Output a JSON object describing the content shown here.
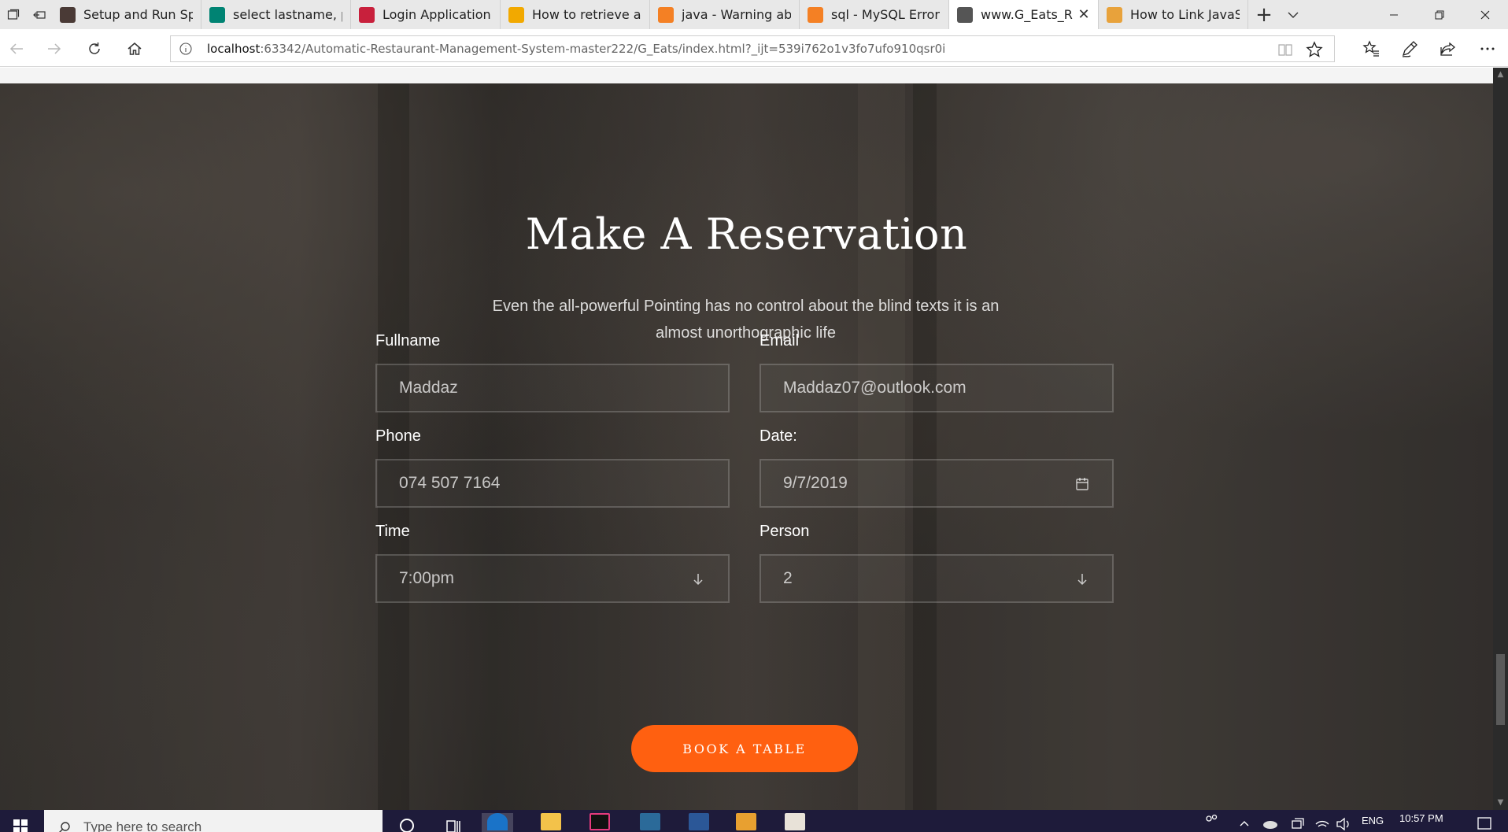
{
  "browser": {
    "tabs": [
      {
        "label": "Setup and Run Spri",
        "favicon": "video-favicon-icon",
        "color": "#4a3a36",
        "active": false
      },
      {
        "label": "select lastname, pa",
        "favicon": "bing-favicon-icon",
        "color": "#008373",
        "active": false
      },
      {
        "label": "Login Application u",
        "favicon": "app-favicon-icon",
        "color": "#c8203c",
        "active": false
      },
      {
        "label": "How to retrieve all",
        "favicon": "star-favicon-icon",
        "color": "#f2a900",
        "active": false
      },
      {
        "label": "java - Warning abo",
        "favicon": "stackoverflow-favicon-icon",
        "color": "#f48024",
        "active": false
      },
      {
        "label": "sql - MySQL Error C",
        "favicon": "stackoverflow-favicon-icon",
        "color": "#f48024",
        "active": false
      },
      {
        "label": "www.G_Eats_Re",
        "favicon": "page-favicon-icon",
        "color": "#555555",
        "active": true
      },
      {
        "label": "How to Link JavaSc",
        "favicon": "search-favicon-icon",
        "color": "#e8a23b",
        "active": false
      }
    ],
    "address": {
      "host": "localhost",
      "rest": ":63342/Automatic-Restaurant-Management-System-master222/G_Eats/index.html?_ijt=539i762o1v3fo7ufo910qsr0i"
    }
  },
  "reservation": {
    "title": "Make A Reservation",
    "subtitle": "Even the all-powerful Pointing has no control about the blind texts it is an almost unorthographic life",
    "fields": {
      "fullname": {
        "label": "Fullname",
        "value": "Maddaz"
      },
      "email": {
        "label": "Email",
        "value": "Maddaz07@outlook.com"
      },
      "phone": {
        "label": "Phone",
        "value": "074 507 7164"
      },
      "date": {
        "label": "Date:",
        "value": "9/7/2019"
      },
      "time": {
        "label": "Time",
        "value": "7:00pm"
      },
      "person": {
        "label": "Person",
        "value": "2"
      }
    },
    "book_button": "BOOK A TABLE",
    "accent_color": "#ff6010"
  },
  "taskbar": {
    "search_placeholder": "Type here to search",
    "language": "ENG",
    "time": "10:57 PM"
  }
}
